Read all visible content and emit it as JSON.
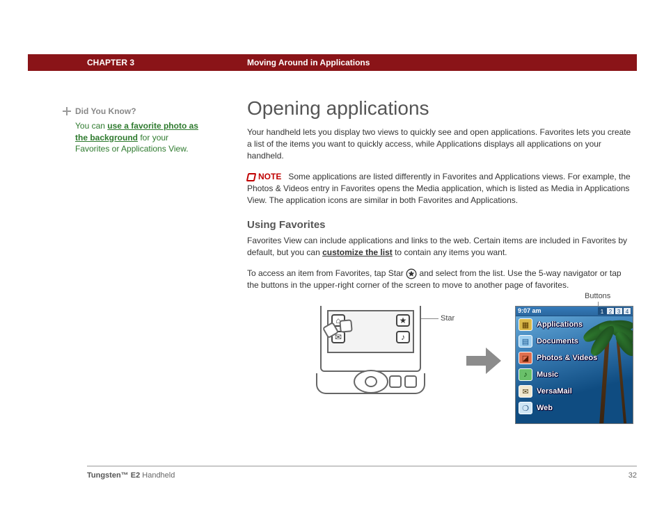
{
  "header": {
    "chapter_label": "CHAPTER 3",
    "chapter_title": "Moving Around in Applications"
  },
  "sidebar": {
    "heading": "Did You Know?",
    "pre": "You can ",
    "link": "use a favorite photo as the background",
    "post": " for your Favorites or Applications View."
  },
  "main": {
    "h1": "Opening applications",
    "intro": "Your handheld lets you display two views to quickly see and open applications. Favorites lets you create a list of the items you want to quickly access, while Applications displays all applications on your handheld.",
    "note_label": "NOTE",
    "note_text": "Some applications are listed differently in Favorites and Applications views. For example, the Photos & Videos entry in Favorites opens the Media application, which is listed as Media in Applications View. The application icons are similar in both Favorites and Applications.",
    "h2": "Using Favorites",
    "fav_p1_a": "Favorites View can include applications and links to the web. Certain items are included in Favorites by default, but you can ",
    "fav_p1_link": "customize the list",
    "fav_p1_b": " to contain any items you want.",
    "fav_p2_a": "To access an item from Favorites, tap Star ",
    "fav_p2_b": " and select from the list. Use the 5-way navigator or tap the buttons in the upper-right corner of the screen to move to another page of favorites."
  },
  "figure": {
    "callout_star": "Star",
    "callout_buttons": "Buttons",
    "device_icons": {
      "tl": "⌂",
      "bl": "✉",
      "tr": "★",
      "br": "♪"
    }
  },
  "palm": {
    "time": "9:07 am",
    "tabs": [
      "1",
      "2",
      "3",
      "4"
    ],
    "rows": [
      {
        "icon": "▦",
        "cls": "pi-app",
        "label": "Applications"
      },
      {
        "icon": "▤",
        "cls": "pi-doc",
        "label": "Documents"
      },
      {
        "icon": "◪",
        "cls": "pi-ph",
        "label": "Photos & Videos"
      },
      {
        "icon": "♪",
        "cls": "pi-mus",
        "label": "Music"
      },
      {
        "icon": "✉",
        "cls": "pi-mail",
        "label": "VersaMail"
      },
      {
        "icon": "❍",
        "cls": "pi-web",
        "label": "Web"
      }
    ]
  },
  "footer": {
    "product_bold": "Tungsten™ E2",
    "product_rest": " Handheld",
    "page": "32"
  }
}
